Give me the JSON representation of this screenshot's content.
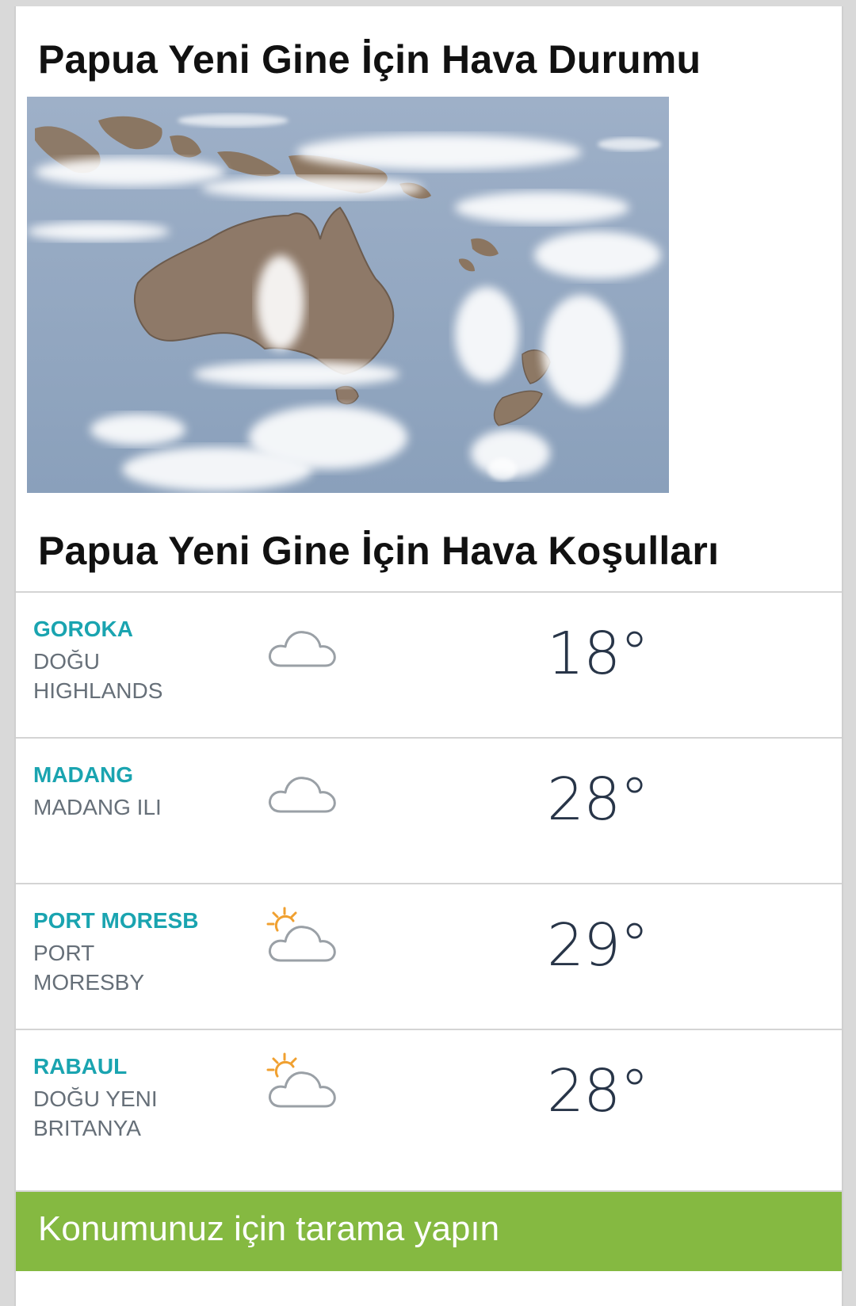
{
  "header": {
    "map_title": "Papua Yeni Gine İçin Hava Durumu",
    "conditions_title": "Papua Yeni Gine İçin Hava Koşulları"
  },
  "colors": {
    "city_accent": "#1aa4b0",
    "region_text": "#666f78",
    "temperature_text": "#283548",
    "scan_bar": "#85b941",
    "sun": "#f0a030",
    "cloud_outline": "#9aa0a6"
  },
  "locations": [
    {
      "city": "GOROKA",
      "region": "DOĞU HIGHLANDS",
      "condition_icon": "cloud-icon",
      "temperature": "18°"
    },
    {
      "city": "MADANG",
      "region": "MADANG ILI",
      "condition_icon": "cloud-icon",
      "temperature": "28°"
    },
    {
      "city": "PORT MORESB",
      "region": "PORT MORESBY",
      "condition_icon": "partly-sunny-icon",
      "temperature": "29°"
    },
    {
      "city": "RABAUL",
      "region": "DOĞU YENI BRITANYA",
      "condition_icon": "partly-sunny-icon",
      "temperature": "28°"
    }
  ],
  "scan_button": {
    "label": "Konumunuz için tarama yapın"
  }
}
